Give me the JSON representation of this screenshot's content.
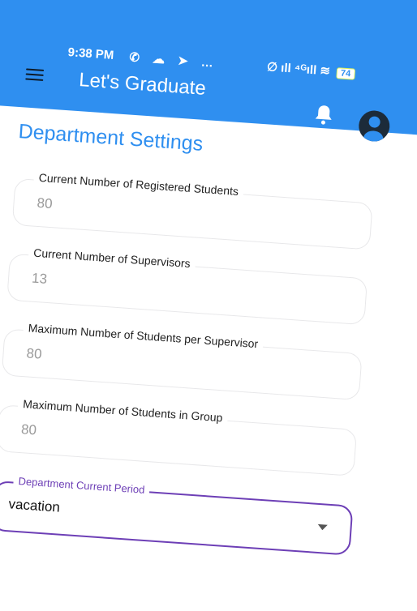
{
  "status_bar": {
    "time": "9:38 PM",
    "left_icons": "✆ ☁ ➤ …",
    "right_icons": "∅ ıll ⁴ᴳıll ≋",
    "battery": "74"
  },
  "app_bar": {
    "title": "Let's Graduate",
    "menu_icon": "menu-icon",
    "notification_icon": "bell-icon",
    "profile_icon": "account-icon"
  },
  "page": {
    "title": "Department Settings"
  },
  "fields": [
    {
      "label": "Current Number of Registered Students",
      "value": "80"
    },
    {
      "label": "Current Number of Supervisors",
      "value": "13"
    },
    {
      "label": "Maximum Number of Students per Supervisor",
      "value": "80"
    },
    {
      "label": "Maximum Number of Students in Group",
      "value": "80"
    }
  ],
  "period_select": {
    "label": "Department Current Period",
    "value": "vacation"
  },
  "colors": {
    "primary": "#2f8ff0",
    "accent": "#6d3fb6"
  }
}
